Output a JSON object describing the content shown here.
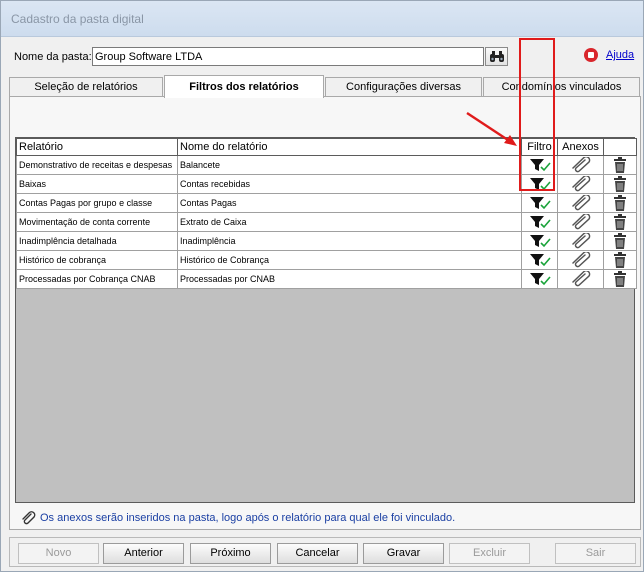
{
  "window": {
    "title": "Cadastro da pasta digital"
  },
  "folder": {
    "label": "Nome da pasta:",
    "value": "Group Software LTDA",
    "find_icon": "binoculars-icon"
  },
  "help": {
    "label": "Ajuda",
    "icon": "help-record-icon"
  },
  "tabs": [
    {
      "label": "Seleção de relatórios",
      "active": false
    },
    {
      "label": "Filtros dos relatórios",
      "active": true
    },
    {
      "label": "Configurações diversas",
      "active": false
    },
    {
      "label": "Condomínios vinculados",
      "active": false
    }
  ],
  "grid": {
    "headers": {
      "report": "Relatório",
      "report_name": "Nome do relatório",
      "filter": "Filtro",
      "attachments": "Anexos"
    },
    "rows": [
      {
        "report": "Demonstrativo de receitas e despesas",
        "name": "Balancete"
      },
      {
        "report": "Baixas",
        "name": "Contas recebidas"
      },
      {
        "report": "Contas Pagas por grupo e classe",
        "name": "Contas Pagas"
      },
      {
        "report": "Movimentação de conta corrente",
        "name": "Extrato de Caixa"
      },
      {
        "report": "Inadimplência detalhada",
        "name": "Inadimplência"
      },
      {
        "report": "Histórico de cobrança",
        "name": "Histórico de Cobrança"
      },
      {
        "report": "Processadas por Cobrança CNAB",
        "name": "Processadas por CNAB"
      }
    ],
    "icons": {
      "filter": "filter-check-icon",
      "attach": "paperclip-icon",
      "delete": "trash-icon"
    }
  },
  "footnote": {
    "text": "Os anexos serão inseridos na pasta, logo após o relatório para qual ele foi vinculado.",
    "icon": "paperclip-icon"
  },
  "buttons": {
    "novo": "Novo",
    "anterior": "Anterior",
    "proximo": "Próximo",
    "cancelar": "Cancelar",
    "gravar": "Gravar",
    "excluir": "Excluir",
    "sair": "Sair"
  },
  "colors": {
    "highlight": "#e01b1b",
    "link": "#0000cc",
    "footnote": "#1a3fa3",
    "check": "#1aa33a"
  }
}
